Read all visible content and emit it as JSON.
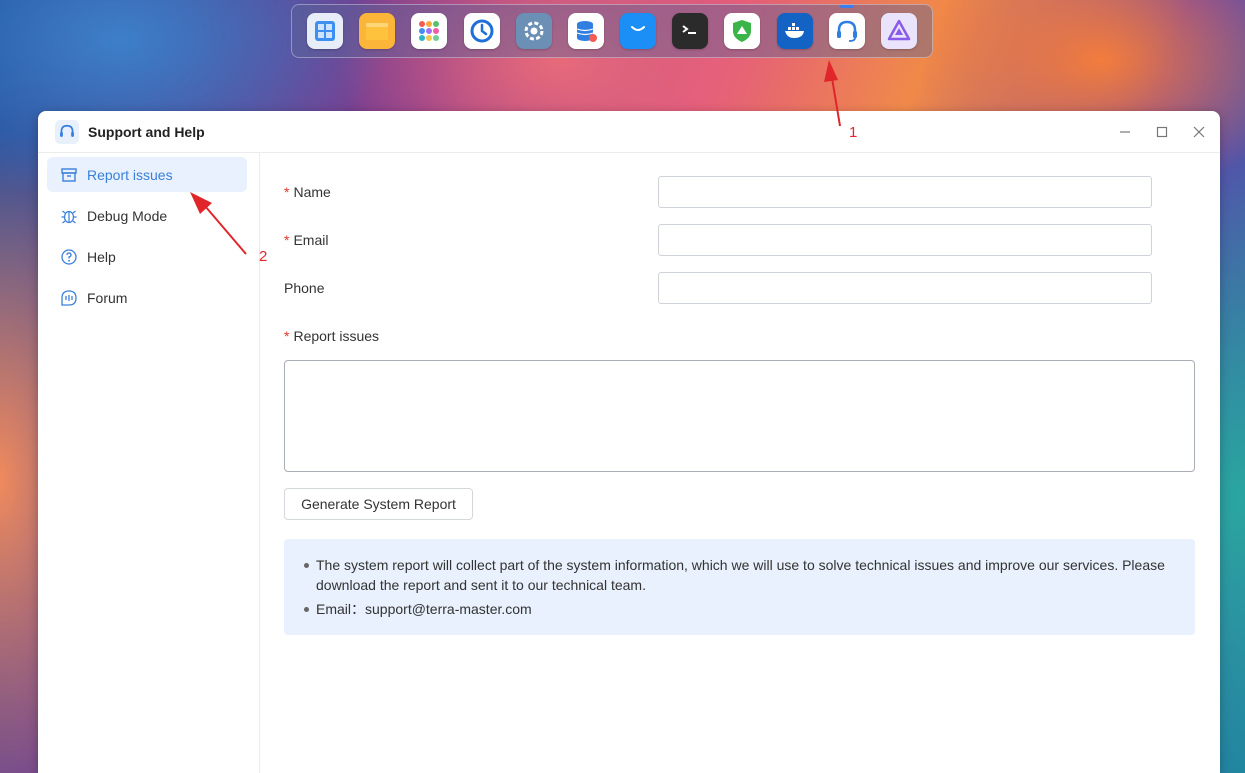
{
  "dock": {
    "apps": [
      {
        "name": "control-panel",
        "color": "#e7eef8"
      },
      {
        "name": "file-manager",
        "color": "#fbb63a"
      },
      {
        "name": "app-center",
        "color": "#ffffff"
      },
      {
        "name": "backup",
        "color": "#ffffff"
      },
      {
        "name": "settings",
        "color": "#6b8fb5"
      },
      {
        "name": "storage-manager",
        "color": "#ffffff"
      },
      {
        "name": "app-store",
        "color": "#1b8ff5"
      },
      {
        "name": "terminal",
        "color": "#2b2b2b"
      },
      {
        "name": "security-advisor",
        "color": "#ffffff"
      },
      {
        "name": "docker",
        "color": "#1363c4"
      },
      {
        "name": "support-and-help",
        "color": "#ffffff",
        "active": true
      },
      {
        "name": "media-server",
        "color": "#e9e4fb"
      }
    ]
  },
  "window": {
    "title": "Support and Help",
    "minimize_icon": "minimize-icon",
    "maximize_icon": "maximize-icon",
    "close_icon": "close-icon"
  },
  "sidebar": {
    "items": [
      {
        "label": "Report issues",
        "icon": "report-icon",
        "active": true
      },
      {
        "label": "Debug Mode",
        "icon": "bug-icon",
        "active": false
      },
      {
        "label": "Help",
        "icon": "help-circle-icon",
        "active": false
      },
      {
        "label": "Forum",
        "icon": "forum-icon",
        "active": false
      }
    ]
  },
  "form": {
    "name_label": "Name",
    "email_label": "Email",
    "phone_label": "Phone",
    "report_label": "Report issues",
    "required_mark": "*",
    "name_value": "",
    "email_value": "",
    "phone_value": "",
    "report_value": "",
    "generate_button": "Generate System Report"
  },
  "info": {
    "line1": "The system report will collect part of the system information, which we will use to solve technical issues and improve our services. Please download the report and sent it to our technical team.",
    "line2": "Email：support@terra-master.com"
  },
  "annotations": {
    "marker1": "1",
    "marker2": "2",
    "color": "#e0262b"
  },
  "colors": {
    "accent": "#3a80d9",
    "active_bg": "#e8f1fd",
    "required": "#e0342b"
  }
}
